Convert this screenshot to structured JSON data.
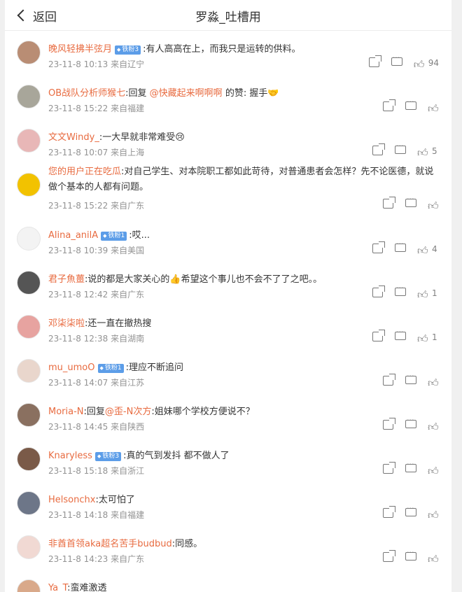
{
  "header": {
    "back_label": "返回",
    "title": "罗淼_吐槽用"
  },
  "comments": [
    {
      "user": "晚风轻拂半弦月",
      "badge": "铁粉3",
      "reply_prefix": "",
      "reply_to": "",
      "text": ":有人高高在上，而我只是运转的供料。",
      "time": "23-11-8 10:13",
      "location": "来自辽宁",
      "likes": "94",
      "avatar_color": "#b98d74"
    },
    {
      "user": "OB战队分析师猴七",
      "badge": "",
      "reply_prefix": ":回复 ",
      "reply_to": "@快藏起来啊啊啊",
      "text": " 的赞: 握手🤝",
      "time": "23-11-8 15:22",
      "location": "来自福建",
      "likes": "",
      "avatar_color": "#a8a69a"
    },
    {
      "user": "文文Windy_",
      "badge": "",
      "reply_prefix": "",
      "reply_to": "",
      "text": ":一大早就非常难受😢",
      "time": "23-11-8 10:07",
      "location": "来自上海",
      "likes": "5",
      "avatar_color": "#e8b7b7"
    },
    {
      "user": "您的用户正在吃瓜",
      "badge": "",
      "reply_prefix": "",
      "reply_to": "",
      "text": ":对自己学生、对本院职工都如此苛待，对普通患者会怎样？先不论医德，就说做个基本的人都有问题。",
      "time": "23-11-8 15:22",
      "location": "来自广东",
      "likes": "",
      "avatar_color": "#f2c200"
    },
    {
      "user": "Alina_anilA",
      "badge": "铁粉1",
      "reply_prefix": "",
      "reply_to": "",
      "text": ":哎...",
      "time": "23-11-8 10:39",
      "location": "来自美国",
      "likes": "4",
      "avatar_color": "#f3f3f3"
    },
    {
      "user": "君子魚薑",
      "badge": "",
      "reply_prefix": "",
      "reply_to": "",
      "text": ":说的都是大家关心的👍希望这个事儿也不会不了了之吧。。",
      "time": "23-11-8 12:42",
      "location": "来自广东",
      "likes": "1",
      "avatar_color": "#555555"
    },
    {
      "user": "邓柒柒啦",
      "badge": "",
      "reply_prefix": "",
      "reply_to": "",
      "text": ":还一直在撤热搜",
      "time": "23-11-8 12:38",
      "location": "来自湖南",
      "likes": "1",
      "avatar_color": "#e7a3a0"
    },
    {
      "user": "mu_umoO",
      "badge": "铁粉1",
      "reply_prefix": "",
      "reply_to": "",
      "text": ":理应不断追问",
      "time": "23-11-8 14:07",
      "location": "来自江苏",
      "likes": "",
      "avatar_color": "#e9d6cc"
    },
    {
      "user": "Moria-N",
      "badge": "",
      "reply_prefix": ":回复",
      "reply_to": "@歪-N次方",
      "text": ":姐妹哪个学校方便说不？",
      "time": "23-11-8 14:45",
      "location": "来自陕西",
      "likes": "",
      "avatar_color": "#8a7060"
    },
    {
      "user": "Knaryless",
      "badge": "铁粉3",
      "reply_prefix": "",
      "reply_to": "",
      "text": ":真的气到发抖 都不做人了",
      "time": "23-11-8 15:18",
      "location": "来自浙江",
      "likes": "",
      "avatar_color": "#7a5a48"
    },
    {
      "user": "Helsonchx",
      "badge": "",
      "reply_prefix": "",
      "reply_to": "",
      "text": ":太可怕了",
      "time": "23-11-8 14:18",
      "location": "来自福建",
      "likes": "",
      "avatar_color": "#6d7688"
    },
    {
      "user": "非酋首领aka超名苦手budbud",
      "badge": "",
      "reply_prefix": "",
      "reply_to": "",
      "text": ":同感。",
      "time": "23-11-8 14:23",
      "location": "来自广东",
      "likes": "",
      "avatar_color": "#f1d9d3"
    },
    {
      "user": "Ya_T",
      "badge": "",
      "reply_prefix": "",
      "reply_to": "",
      "text": ":蛮难激透",
      "time": "",
      "location": "",
      "likes": "",
      "avatar_color": "#d9a98a"
    }
  ]
}
